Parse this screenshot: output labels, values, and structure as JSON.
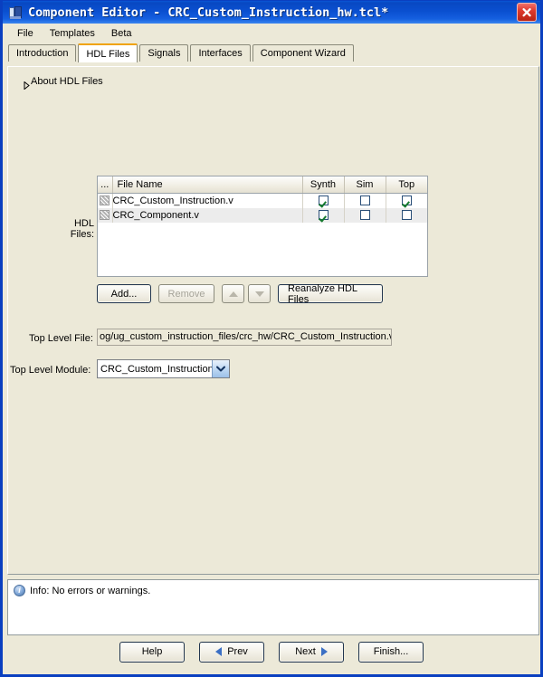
{
  "window": {
    "title": "Component Editor - CRC_Custom_Instruction_hw.tcl*",
    "icon": "component-editor-icon",
    "close_label": "close-icon",
    "accent_orange": "#f0a30a",
    "titlebar_blue": "#0a4fd0"
  },
  "menubar": {
    "items": [
      {
        "label": "File"
      },
      {
        "label": "Templates"
      },
      {
        "label": "Beta"
      }
    ]
  },
  "tabs": [
    {
      "label": "Introduction",
      "active": false
    },
    {
      "label": "HDL Files",
      "active": true
    },
    {
      "label": "Signals",
      "active": false
    },
    {
      "label": "Interfaces",
      "active": false
    },
    {
      "label": "Component Wizard",
      "active": false
    }
  ],
  "main": {
    "about_label": "About HDL Files",
    "hdl_files_label": "HDL Files:",
    "table": {
      "columns": [
        "...",
        "File Name",
        "Synth",
        "Sim",
        "Top"
      ],
      "rows": [
        {
          "icon": "file-icon",
          "name": "CRC_Custom_Instruction.v",
          "synth": true,
          "sim": false,
          "top": true
        },
        {
          "icon": "file-icon",
          "name": "CRC_Component.v",
          "synth": true,
          "sim": false,
          "top": false
        }
      ]
    },
    "buttons": {
      "add": "Add...",
      "remove": "Remove",
      "move_up": "move-up-icon",
      "move_down": "move-down-icon",
      "reanalyze": "Reanalyze HDL Files"
    },
    "top_level_file": {
      "label": "Top Level File:",
      "value": "og/ug_custom_instruction_files/crc_hw/CRC_Custom_Instruction.v"
    },
    "top_level_module": {
      "label": "Top Level Module:",
      "value": "CRC_Custom_Instruction"
    }
  },
  "info": {
    "icon": "info-icon",
    "message": "Info: No errors or warnings."
  },
  "footer": {
    "help": "Help",
    "prev": "Prev",
    "next": "Next",
    "finish": "Finish..."
  }
}
